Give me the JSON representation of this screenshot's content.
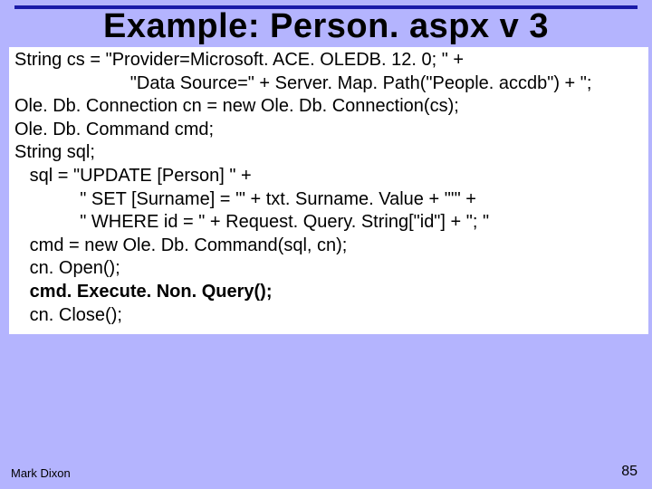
{
  "title": "Example: Person. aspx v 3",
  "code": {
    "l1": "String cs = \"Provider=Microsoft. ACE. OLEDB. 12. 0; \" +",
    "l2": "                       \"Data Source=\" + Server. Map. Path(\"People. accdb\") + \"; ",
    "l3": "Ole. Db. Connection cn = new Ole. Db. Connection(cs);",
    "l4": "Ole. Db. Command cmd;",
    "l5": "String sql;",
    "l6": "   sql = \"UPDATE [Person] \" +",
    "l7": "             \" SET [Surname] = '\" + txt. Surname. Value + \"'\" +",
    "l8": "             \" WHERE id = \" + Request. Query. String[\"id\"] + \"; \"",
    "l9": "   cmd = new Ole. Db. Command(sql, cn);",
    "l10": "   cn. Open();",
    "l11": "   cmd. Execute. Non. Query();",
    "l12": "   cn. Close();"
  },
  "footer": {
    "author": "Mark Dixon",
    "page": "85"
  }
}
